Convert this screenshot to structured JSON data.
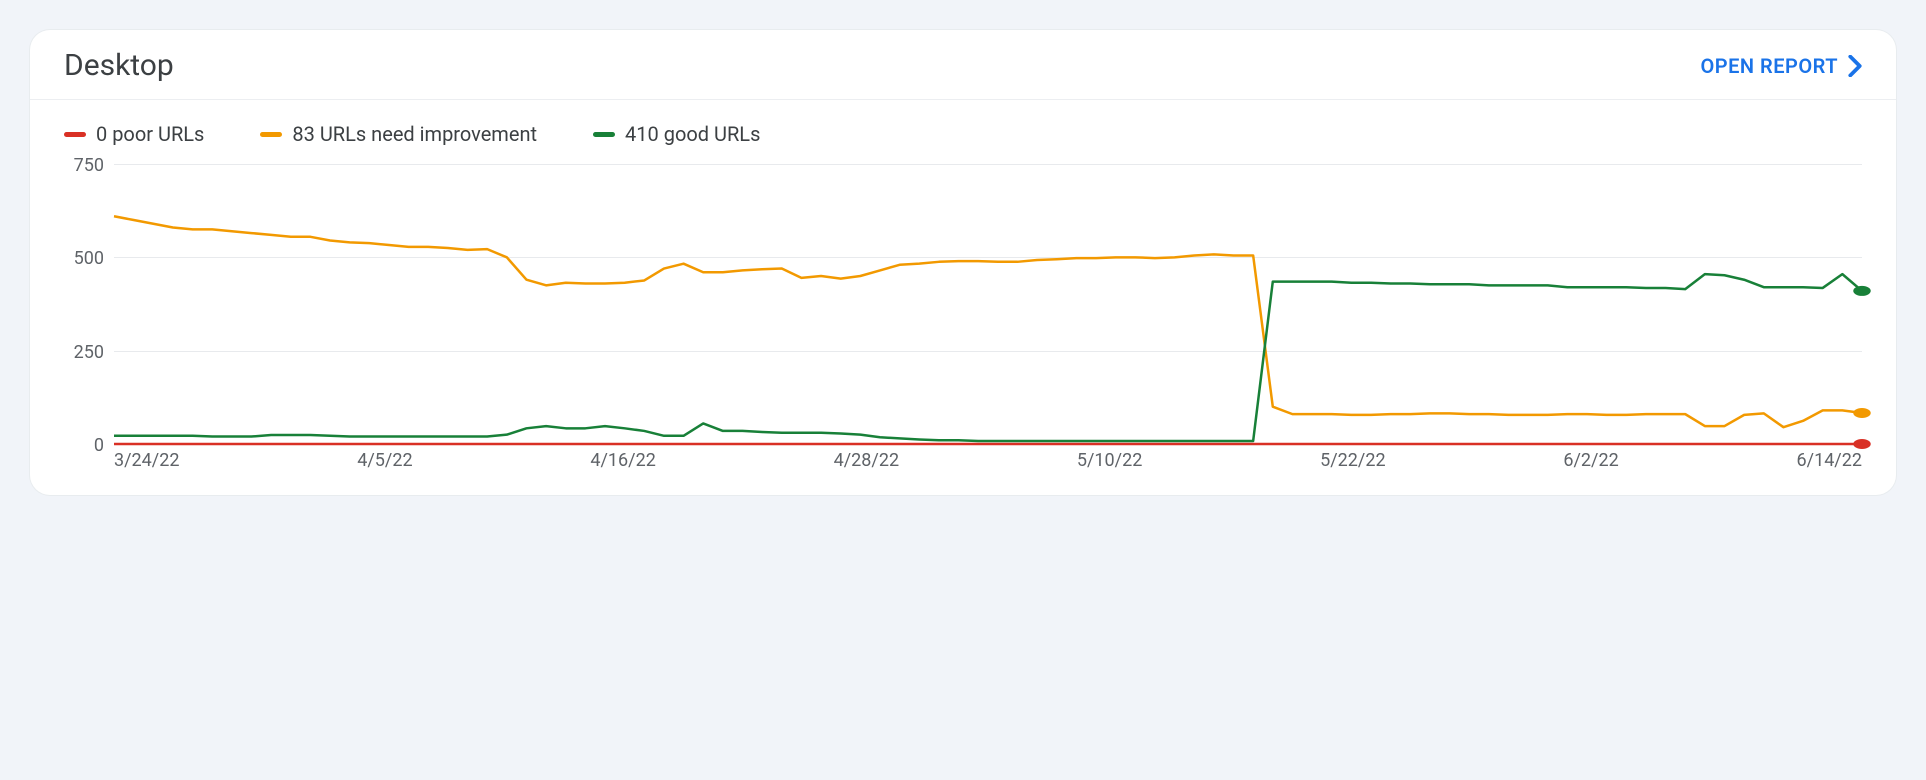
{
  "header": {
    "title": "Desktop",
    "open_report": "OPEN REPORT"
  },
  "legend": {
    "poor": "0 poor URLs",
    "need": "83 URLs need improvement",
    "good": "410 good URLs"
  },
  "colors": {
    "poor": "#d93025",
    "need": "#f29900",
    "good": "#188038",
    "grid": "#e8eaed",
    "axis_text": "#5f6368"
  },
  "chart_data": {
    "type": "line",
    "ylim": [
      0,
      750
    ],
    "y_ticks": [
      0,
      250,
      500,
      750
    ],
    "x_ticks": [
      "3/24/22",
      "4/5/22",
      "4/16/22",
      "4/28/22",
      "5/10/22",
      "5/22/22",
      "6/2/22",
      "6/14/22"
    ],
    "n_points": 90,
    "series": [
      {
        "name": "poor",
        "color": "#d93025",
        "end_dot": true,
        "values": [
          0,
          0,
          0,
          0,
          0,
          0,
          0,
          0,
          0,
          0,
          0,
          0,
          0,
          0,
          0,
          0,
          0,
          0,
          0,
          0,
          0,
          0,
          0,
          0,
          0,
          0,
          0,
          0,
          0,
          0,
          0,
          0,
          0,
          0,
          0,
          0,
          0,
          0,
          0,
          0,
          0,
          0,
          0,
          0,
          0,
          0,
          0,
          0,
          0,
          0,
          0,
          0,
          0,
          0,
          0,
          0,
          0,
          0,
          0,
          0,
          0,
          0,
          0,
          0,
          0,
          0,
          0,
          0,
          0,
          0,
          0,
          0,
          0,
          0,
          0,
          0,
          0,
          0,
          0,
          0,
          0,
          0,
          0,
          0,
          0,
          0,
          0,
          0,
          0,
          0
        ]
      },
      {
        "name": "need",
        "color": "#f29900",
        "end_dot": true,
        "values": [
          610,
          600,
          590,
          580,
          575,
          575,
          570,
          565,
          560,
          555,
          555,
          545,
          540,
          538,
          533,
          528,
          528,
          525,
          520,
          522,
          500,
          440,
          425,
          432,
          430,
          430,
          432,
          438,
          470,
          483,
          460,
          460,
          465,
          468,
          470,
          445,
          450,
          443,
          450,
          465,
          480,
          483,
          488,
          490,
          490,
          488,
          488,
          493,
          495,
          498,
          498,
          500,
          500,
          498,
          500,
          505,
          508,
          505,
          505,
          100,
          80,
          80,
          80,
          78,
          78,
          80,
          80,
          82,
          82,
          80,
          80,
          78,
          78,
          78,
          80,
          80,
          78,
          78,
          80,
          80,
          80,
          48,
          48,
          78,
          82,
          45,
          62,
          90,
          90,
          83
        ]
      },
      {
        "name": "good",
        "color": "#188038",
        "end_dot": true,
        "values": [
          22,
          22,
          22,
          22,
          22,
          20,
          20,
          20,
          24,
          24,
          24,
          22,
          20,
          20,
          20,
          20,
          20,
          20,
          20,
          20,
          25,
          42,
          48,
          42,
          42,
          48,
          42,
          35,
          22,
          22,
          55,
          35,
          35,
          32,
          30,
          30,
          30,
          28,
          25,
          18,
          15,
          12,
          10,
          10,
          8,
          8,
          8,
          8,
          8,
          8,
          8,
          8,
          8,
          8,
          8,
          8,
          8,
          8,
          8,
          435,
          435,
          435,
          435,
          432,
          432,
          430,
          430,
          428,
          428,
          428,
          425,
          425,
          425,
          425,
          420,
          420,
          420,
          420,
          418,
          418,
          415,
          455,
          452,
          440,
          420,
          420,
          420,
          418,
          455,
          410
        ]
      }
    ]
  }
}
